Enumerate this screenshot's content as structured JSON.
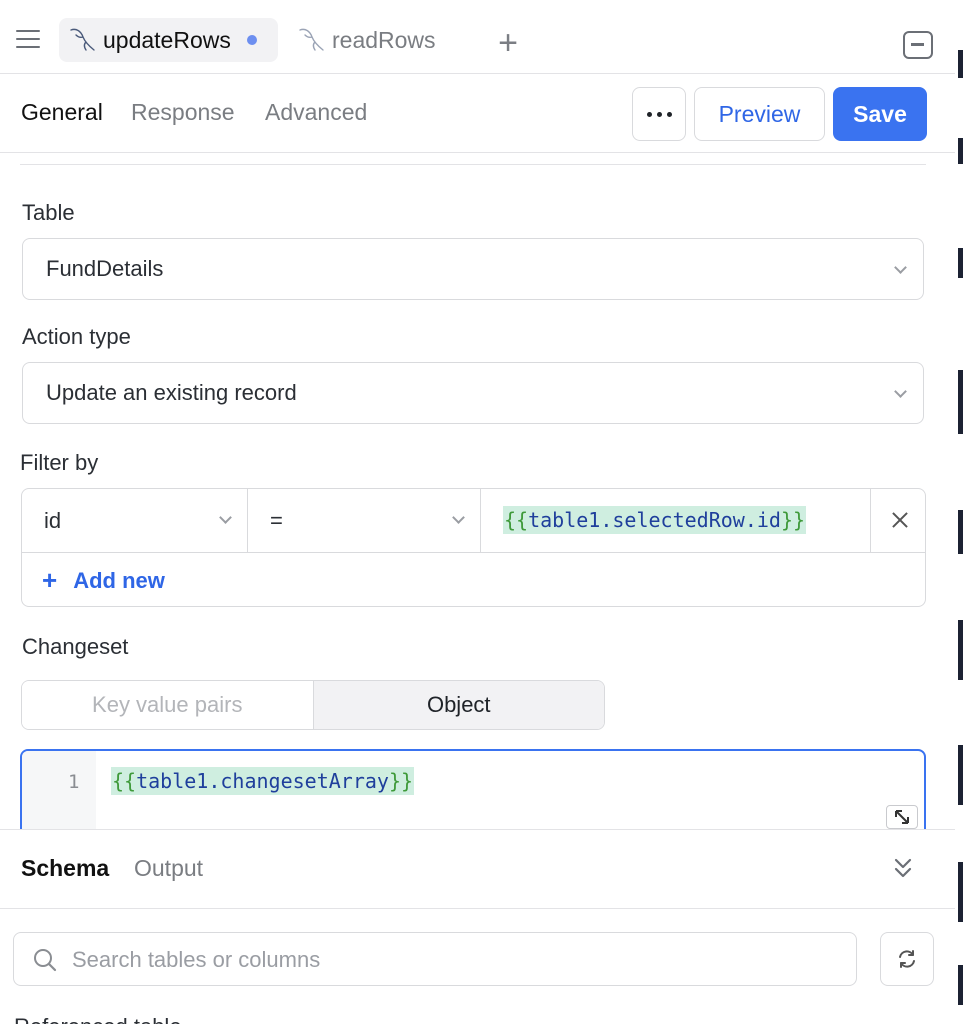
{
  "tabs": [
    {
      "label": "updateRows",
      "icon": "mysql-dolphin-icon",
      "active": true,
      "unsaved": true
    },
    {
      "label": "readRows",
      "icon": "mysql-dolphin-icon",
      "active": false,
      "unsaved": false
    }
  ],
  "subtabs": {
    "general": "General",
    "response": "Response",
    "advanced": "Advanced"
  },
  "toolbar": {
    "more_icon": "ellipsis-icon",
    "preview_label": "Preview",
    "save_label": "Save"
  },
  "form": {
    "table_label": "Table",
    "table_value": "FundDetails",
    "action_label": "Action type",
    "action_value": "Update an existing record",
    "filter_label": "Filter by",
    "filter": {
      "column": "id",
      "operator": "=",
      "value_open": "{{",
      "value_expr": "table1.selectedRow.id",
      "value_close": "}}"
    },
    "add_new_label": "Add new",
    "changeset_label": "Changeset",
    "changeset_modes": {
      "kv": "Key value pairs",
      "object": "Object"
    },
    "editor": {
      "line_number": "1",
      "code_open": "{{",
      "code_expr": "table1.changesetArray",
      "code_close": "}}"
    }
  },
  "bottom": {
    "schema_tab": "Schema",
    "output_tab": "Output",
    "search_placeholder": "Search tables or columns",
    "refresh_icon": "refresh-icon",
    "cut_text": "Referenced table"
  },
  "colors": {
    "accent": "#3a73f0",
    "link": "#2f66e6",
    "code_highlight": "#cfeee0",
    "unsaved_dot": "#6d8ff0"
  }
}
